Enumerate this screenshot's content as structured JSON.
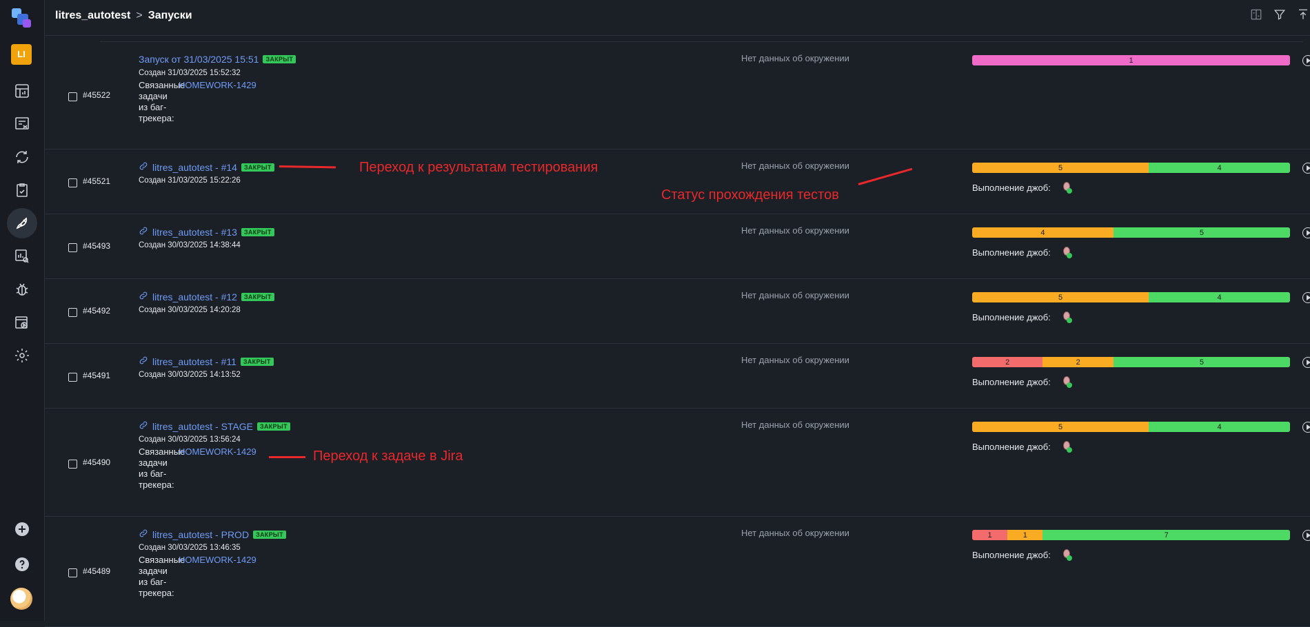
{
  "app": {
    "project_initials": "LI",
    "breadcrumb": {
      "project": "litres_autotest",
      "separator": ">",
      "page": "Запуски"
    }
  },
  "colors": {
    "accent": "#6f9cf6",
    "failed": "#f36b6b",
    "broken": "#f9ab24",
    "passed": "#4cd964",
    "unknown": "#f06bc7",
    "badge": "#34c759",
    "annotation": "#e8282b"
  },
  "labels": {
    "env_empty": "Нет данных об окружении",
    "jobs": "Выполнение джоб:",
    "tasks": [
      "Связанные",
      "задачи",
      "из баг-",
      "трекера:"
    ]
  },
  "launches": [
    {
      "id": "#45522",
      "title": "Запуск от 31/03/2025 15:51",
      "icon": "",
      "badge": "ЗАКРЫТ",
      "created": "Создан 31/03/2025 15:52:32",
      "task": "HOMEWORK-1429",
      "stats": [
        {
          "status": "unknown",
          "value": 1
        }
      ],
      "jobs": false
    },
    {
      "id": "#45521",
      "title": "litres_autotest - #14",
      "icon": "link-icon",
      "badge": "ЗАКРЫТ",
      "created": "Создан 31/03/2025 15:22:26",
      "task": "",
      "stats": [
        {
          "status": "broken",
          "value": 5
        },
        {
          "status": "passed",
          "value": 4
        }
      ],
      "jobs": true
    },
    {
      "id": "#45493",
      "title": "litres_autotest - #13",
      "icon": "link-icon",
      "badge": "ЗАКРЫТ",
      "created": "Создан 30/03/2025 14:38:44",
      "task": "",
      "stats": [
        {
          "status": "broken",
          "value": 4
        },
        {
          "status": "passed",
          "value": 5
        }
      ],
      "jobs": true
    },
    {
      "id": "#45492",
      "title": "litres_autotest - #12",
      "icon": "link-icon",
      "badge": "ЗАКРЫТ",
      "created": "Создан 30/03/2025 14:20:28",
      "task": "",
      "stats": [
        {
          "status": "broken",
          "value": 5
        },
        {
          "status": "passed",
          "value": 4
        }
      ],
      "jobs": true
    },
    {
      "id": "#45491",
      "title": "litres_autotest - #11",
      "icon": "link-icon",
      "badge": "ЗАКРЫТ",
      "created": "Создан 30/03/2025 14:13:52",
      "task": "",
      "stats": [
        {
          "status": "failed",
          "value": 2
        },
        {
          "status": "broken",
          "value": 2
        },
        {
          "status": "passed",
          "value": 5
        }
      ],
      "jobs": true
    },
    {
      "id": "#45490",
      "title": "litres_autotest - STAGE",
      "icon": "link-icon",
      "badge": "ЗАКРЫТ",
      "created": "Создан 30/03/2025 13:56:24",
      "task": "HOMEWORK-1429",
      "stats": [
        {
          "status": "broken",
          "value": 5
        },
        {
          "status": "passed",
          "value": 4
        }
      ],
      "jobs": true
    },
    {
      "id": "#45489",
      "title": "litres_autotest - PROD",
      "icon": "link-icon",
      "badge": "ЗАКРЫТ",
      "created": "Создан 30/03/2025 13:46:35",
      "task": "HOMEWORK-1429",
      "stats": [
        {
          "status": "failed",
          "value": 1
        },
        {
          "status": "broken",
          "value": 1
        },
        {
          "status": "passed",
          "value": 7
        }
      ],
      "jobs": true
    }
  ],
  "annotations": {
    "results": "Переход к результатам тестирования",
    "status": "Статус прохождения тестов",
    "jira": "Переход к задаче в Jira"
  }
}
